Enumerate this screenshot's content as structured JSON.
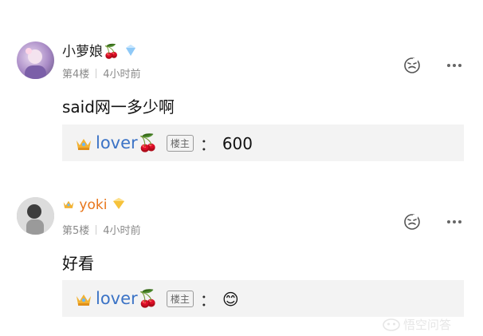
{
  "comments": [
    {
      "username": "小萝娘🍒",
      "floor": "第4楼",
      "time": "4小时前",
      "text": "said网一多少啊",
      "reply": {
        "author": "lover🍒",
        "role_badge": "楼主",
        "colon": "：",
        "text": "600"
      }
    },
    {
      "username": "yoki",
      "floor": "第5楼",
      "time": "4小时前",
      "text": "好看",
      "reply": {
        "author": "lover🍒",
        "role_badge": "楼主",
        "colon": "：",
        "text": "😊"
      }
    }
  ],
  "watermark": "悟空问答",
  "colors": {
    "reply_name": "#3b73c6",
    "username_vip": "#e8751a",
    "meta": "#8a8a8a"
  }
}
